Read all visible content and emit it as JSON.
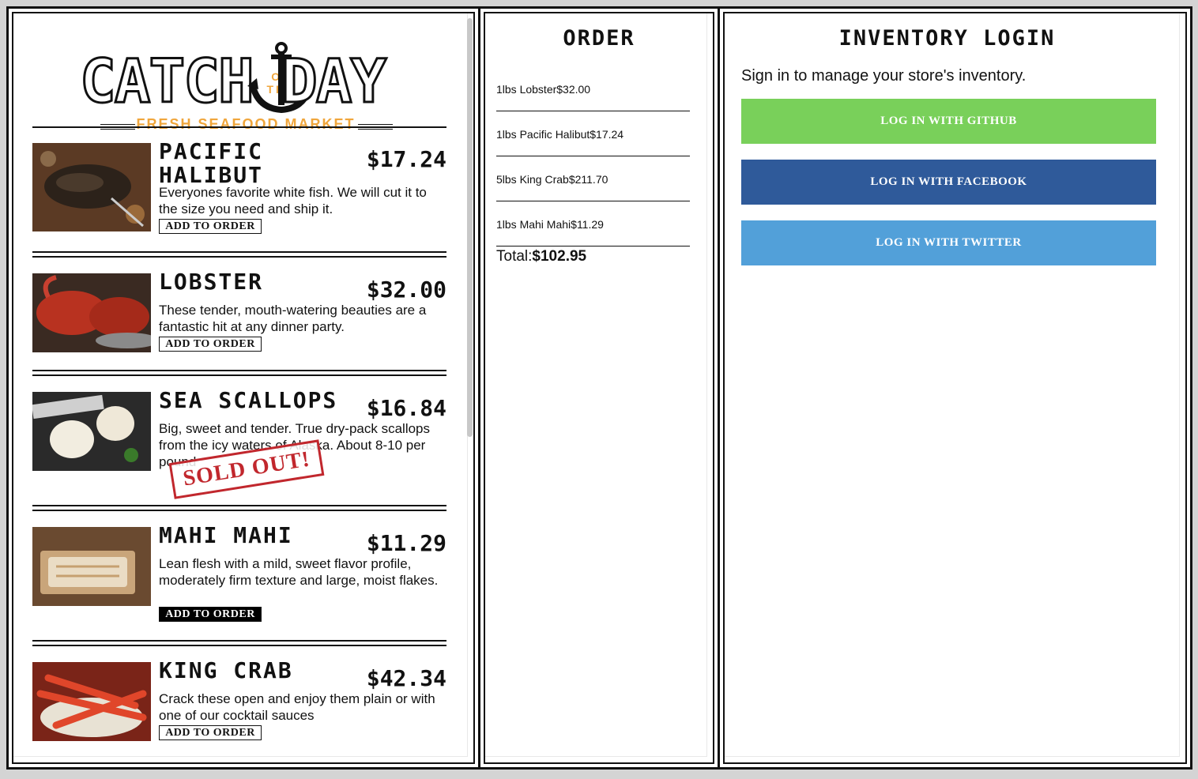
{
  "menu": {
    "logo": {
      "word1": "CATCH",
      "ofthe": "OF THE",
      "word2": "DAY",
      "tagline": "FRESH SEAFOOD MARKET"
    },
    "add_label": "ADD TO ORDER",
    "sold_out": "SOLD OUT!",
    "fishes": [
      {
        "name": "PACIFIC HALIBUT",
        "price": "$17.24",
        "desc": "Everyones favorite white fish. We will cut it to the size you need and ship it.",
        "image": "halibut"
      },
      {
        "name": "LOBSTER",
        "price": "$32.00",
        "desc": "These tender, mouth-watering beauties are a fantastic hit at any dinner party.",
        "image": "lobster"
      },
      {
        "name": "SEA SCALLOPS",
        "price": "$16.84",
        "desc": "Big, sweet and tender. True dry-pack scallops from the icy waters of Alaska. About 8-10 per pound",
        "image": "scallops"
      },
      {
        "name": "MAHI MAHI",
        "price": "$11.29",
        "desc": "Lean flesh with a mild, sweet flavor profile, moderately firm texture and large, moist flakes.",
        "image": "mahi"
      },
      {
        "name": "KING CRAB",
        "price": "$42.34",
        "desc": "Crack these open and enjoy them plain or with one of our cocktail sauces",
        "image": "crab"
      }
    ]
  },
  "order": {
    "title": "ORDER",
    "items": [
      {
        "text": "1lbs Lobster$32.00"
      },
      {
        "text": "1lbs Pacific Halibut$17.24"
      },
      {
        "text": "5lbs King Crab$211.70"
      },
      {
        "text": "1lbs Mahi Mahi$11.29"
      }
    ],
    "total_label": "Total:",
    "total_value": "$102.95"
  },
  "inventory": {
    "title": "INVENTORY LOGIN",
    "desc": "Sign in to manage your store's inventory.",
    "github": "LOG IN WITH GITHUB",
    "facebook": "LOG IN WITH FACEBOOK",
    "twitter": "LOG IN WITH TWITTER",
    "colors": {
      "github": "#79d05a",
      "facebook": "#2f5a9a",
      "twitter": "#52a0d9"
    }
  }
}
